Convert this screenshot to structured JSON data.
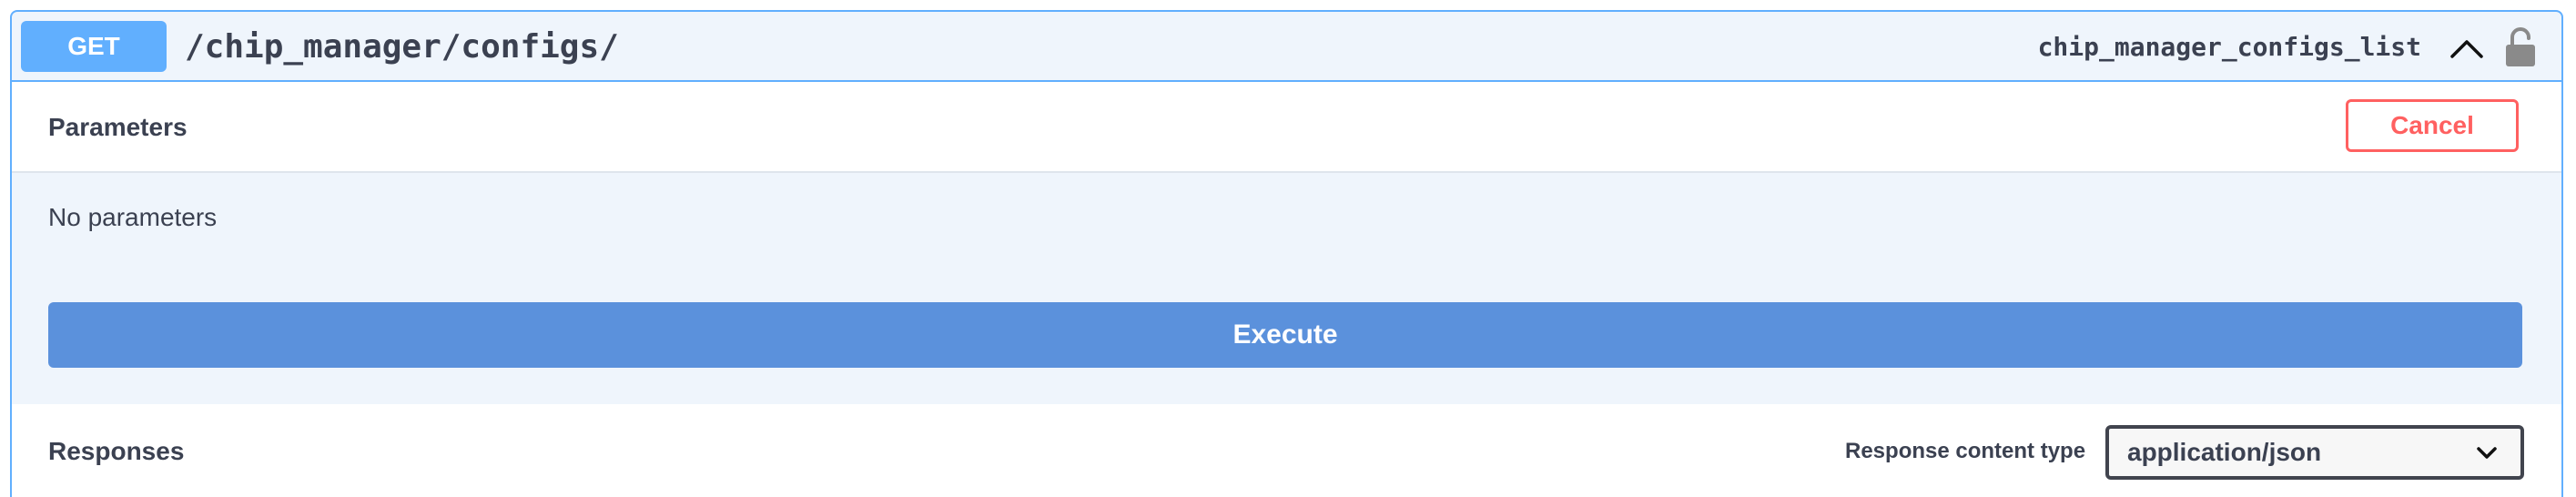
{
  "operation": {
    "method": "GET",
    "path": "/chip_manager/configs/",
    "operation_id": "chip_manager_configs_list",
    "collapse_icon": "chevron-up-icon",
    "auth_icon": "unlocked-padlock-icon",
    "accent_color": "#61affe"
  },
  "parameters": {
    "title": "Parameters",
    "cancel_label": "Cancel",
    "empty_text": "No parameters"
  },
  "execute": {
    "label": "Execute"
  },
  "responses": {
    "title": "Responses",
    "content_type_label": "Response content type",
    "content_type_value": "application/json"
  }
}
